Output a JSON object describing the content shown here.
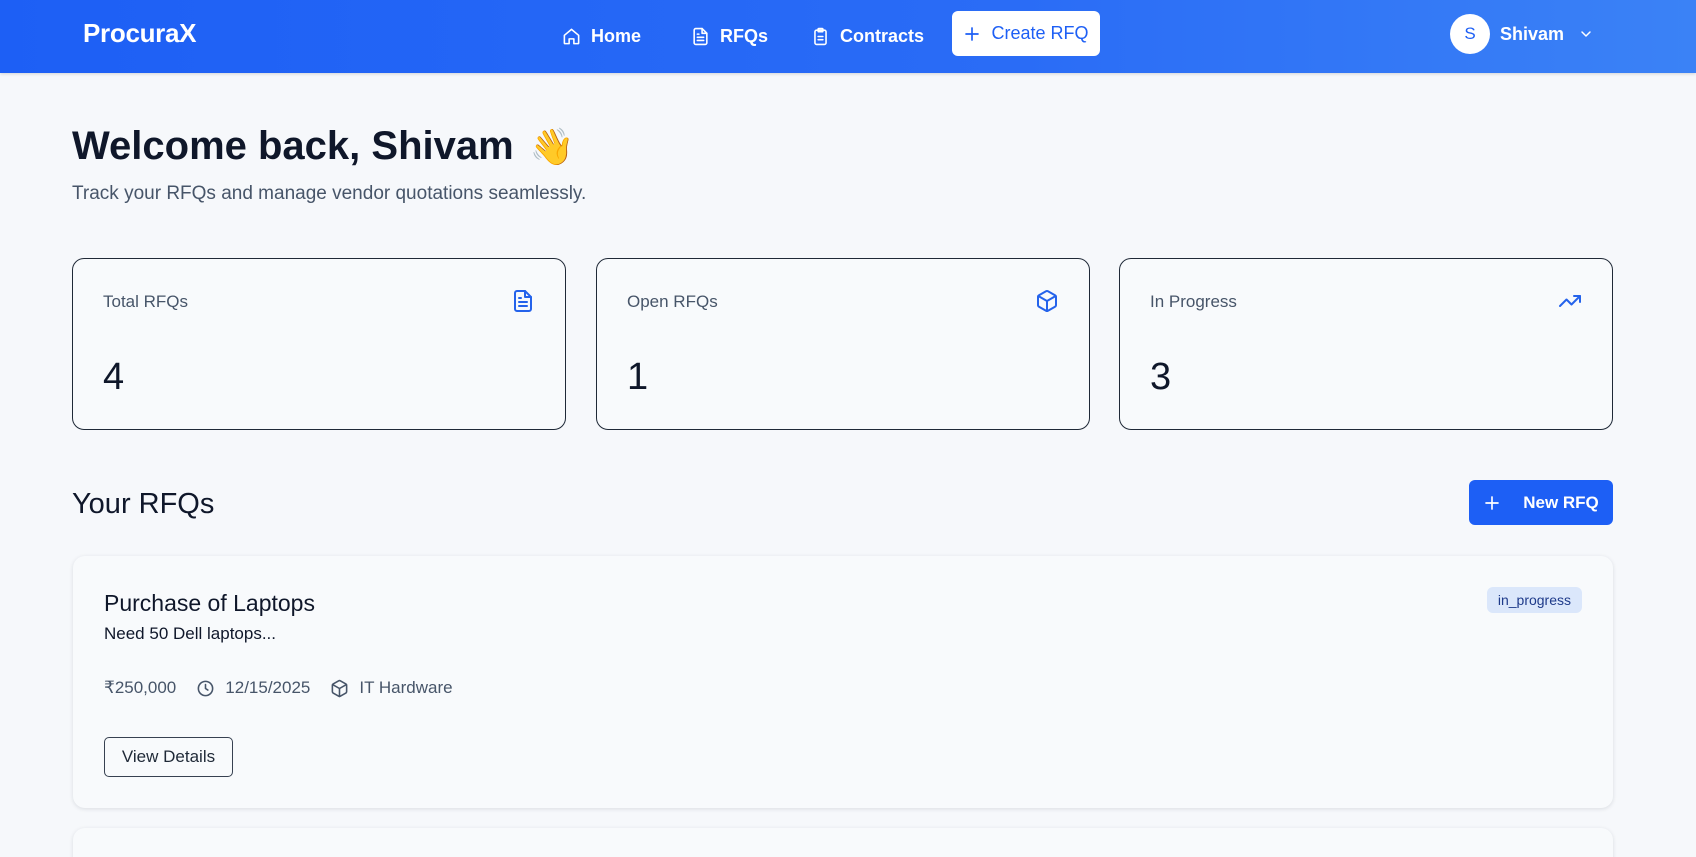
{
  "header": {
    "logo": "ProcuraX",
    "nav": [
      {
        "label": "Home",
        "icon": "home-icon"
      },
      {
        "label": "RFQs",
        "icon": "file-text-icon"
      },
      {
        "label": "Contracts",
        "icon": "clipboard-icon"
      }
    ],
    "create_label": "Create RFQ",
    "user": {
      "initial": "S",
      "name": "Shivam"
    }
  },
  "welcome": {
    "title": "Welcome back, Shivam",
    "emoji": "👋",
    "subtitle": "Track your RFQs and manage vendor quotations seamlessly."
  },
  "stats": [
    {
      "label": "Total RFQs",
      "value": "4",
      "icon": "file-text-icon"
    },
    {
      "label": "Open RFQs",
      "value": "1",
      "icon": "package-icon"
    },
    {
      "label": "In Progress",
      "value": "3",
      "icon": "trending-up-icon"
    }
  ],
  "section": {
    "title": "Your RFQs",
    "new_label": "New RFQ"
  },
  "rfqs": [
    {
      "title": "Purchase of Laptops",
      "description": "Need 50 Dell laptops...",
      "status": "in_progress",
      "budget": "₹250,000",
      "deadline": "12/15/2025",
      "category": "IT Hardware",
      "action_label": "View Details"
    }
  ],
  "colors": {
    "primary": "#1d5ff5",
    "badge_bg": "#dbe7fb",
    "background": "#f6f8fb"
  }
}
